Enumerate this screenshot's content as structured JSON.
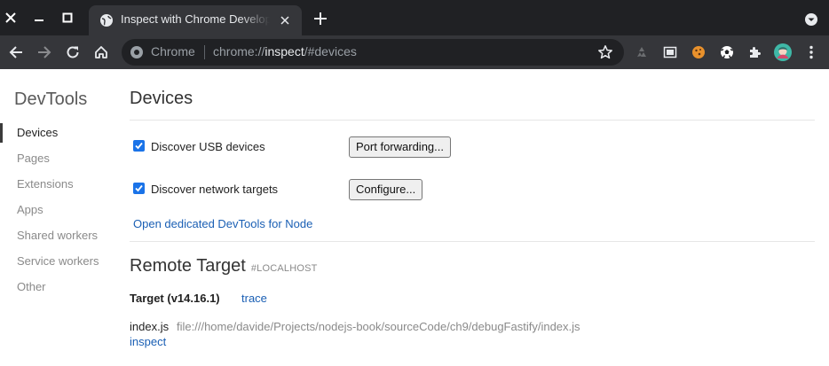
{
  "window": {
    "tab": {
      "title": "Inspect with Chrome Developer Tools",
      "favicon": "globe-icon"
    },
    "controls": [
      "close-icon",
      "minimize-icon",
      "maximize-icon"
    ]
  },
  "toolbar": {
    "omnibox": {
      "chip": "Chrome",
      "url_prefix": "chrome://",
      "url_host": "inspect",
      "url_suffix": "/#devices"
    },
    "extensions": [
      "recycle-icon",
      "screen-capture-icon",
      "cookie-icon",
      "soccer-ball-icon",
      "puzzle-icon",
      "profile-avatar-icon",
      "more-icon"
    ]
  },
  "sidebar": {
    "title": "DevTools",
    "items": [
      {
        "label": "Devices",
        "active": true
      },
      {
        "label": "Pages"
      },
      {
        "label": "Extensions"
      },
      {
        "label": "Apps"
      },
      {
        "label": "Shared workers"
      },
      {
        "label": "Service workers"
      },
      {
        "label": "Other"
      }
    ]
  },
  "main": {
    "heading": "Devices",
    "usb": {
      "label": "Discover USB devices",
      "checked": true,
      "button": "Port forwarding..."
    },
    "network": {
      "label": "Discover network targets",
      "checked": true,
      "button": "Configure..."
    },
    "node_link": "Open dedicated DevTools for Node",
    "remote": {
      "title": "Remote Target",
      "tag": "#LOCALHOST"
    },
    "target": {
      "name": "Target (v14.16.1)",
      "trace_link": "trace",
      "file": "index.js",
      "path": "file:///home/davide/Projects/nodejs-book/sourceCode/ch9/debugFastify/index.js",
      "inspect_link": "inspect"
    }
  },
  "colors": {
    "accent": "#1a73e8",
    "link": "#1a5fb4",
    "chrome_dark": "#202124",
    "chrome_toolbar": "#35363a"
  }
}
